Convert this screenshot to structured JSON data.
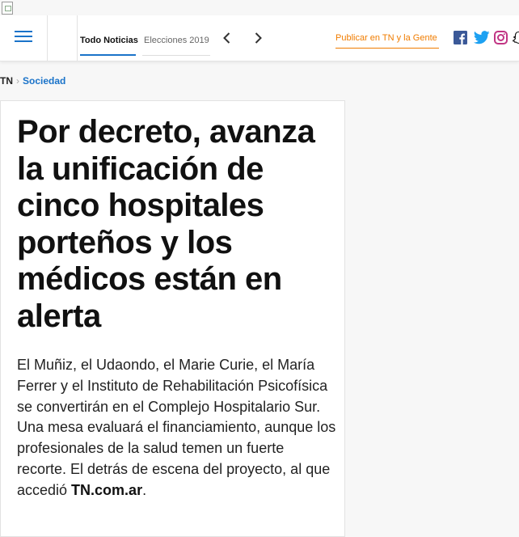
{
  "header": {
    "tabs": [
      {
        "label": "Todo Noticias",
        "active": true
      },
      {
        "label": "Elecciones 2019",
        "active": false
      }
    ],
    "publish_label": "Publicar en TN y la Gente",
    "social": [
      "facebook-icon",
      "twitter-icon",
      "instagram-icon",
      "snapchat-icon"
    ],
    "colors": {
      "accent": "#1a73c9",
      "publish": "#f07c00",
      "facebook": "#3b5998",
      "twitter": "#1da1f2",
      "instagram": "#c13584"
    }
  },
  "breadcrumb": {
    "home": "TN",
    "section": "Sociedad"
  },
  "article": {
    "headline": "Por decreto, avanza la unificación de cinco hospitales porteños y los médicos están en alerta",
    "lead": "El Muñiz, el Udaondo, el Marie Curie, el María Ferrer y el Instituto de Rehabilitación Psicofísica se convertirán en el Complejo Hospitalario Sur. Una mesa evaluará el financiamiento, aunque los profesionales de la salud temen un fuerte recorte. El detrás de escena del proyecto, al que accedió ",
    "lead_source": "TN.com.ar",
    "lead_end": "."
  }
}
